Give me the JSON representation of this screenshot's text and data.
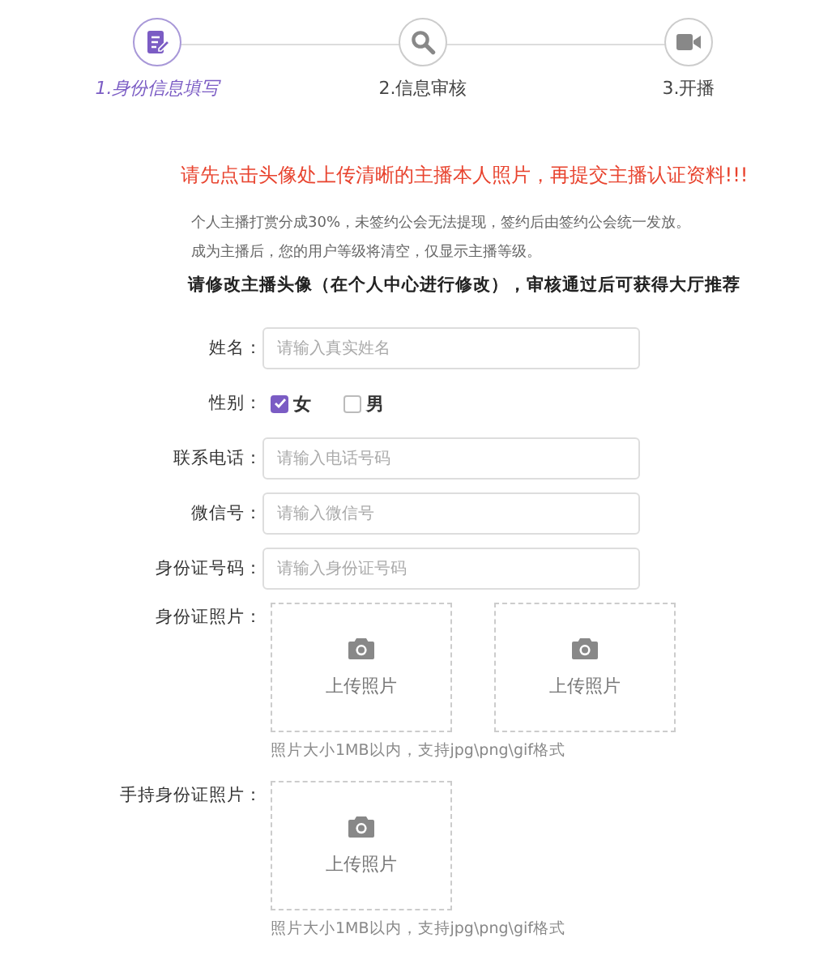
{
  "steps": [
    {
      "label": "1.身份信息填写",
      "kind": "edit",
      "selected": true
    },
    {
      "label": "2.信息审核",
      "kind": "search",
      "selected": false
    },
    {
      "label": "3.开播",
      "kind": "video",
      "selected": false
    }
  ],
  "warning": "请先点击头像处上传清晰的主播本人照片，再提交主播认证资料!!!",
  "notes": [
    "个人主播打赏分成30%，未签约公会无法提现，签约后由签约公会统一发放。",
    "成为主播后，您的用户等级将清空，仅显示主播等级。"
  ],
  "avatar_notice": "请修改主播头像（在个人中心进行修改），审核通过后可获得大厅推荐",
  "form": [
    {
      "kind": "text",
      "label": "姓名：",
      "placeholder": "请输入真实姓名"
    },
    {
      "kind": "radio",
      "label": "性别：",
      "options": [
        {
          "label": "女",
          "checked": true
        },
        {
          "label": "男",
          "checked": false
        }
      ]
    },
    {
      "kind": "text",
      "label": "联系电话：",
      "placeholder": "请输入电话号码"
    },
    {
      "kind": "text",
      "label": "微信号：",
      "placeholder": "请输入微信号"
    },
    {
      "kind": "text",
      "label": "身份证号码：",
      "placeholder": "请输入身份证号码"
    },
    {
      "kind": "upload",
      "label": "身份证照片：",
      "slots": [
        "上传照片",
        "上传照片"
      ],
      "hint": "照片大小1MB以内，支持jpg\\png\\gif格式"
    },
    {
      "kind": "upload",
      "label": "手持身份证照片：",
      "slots": [
        "上传照片"
      ],
      "hint": "照片大小1MB以内，支持jpg\\png\\gif格式"
    }
  ]
}
